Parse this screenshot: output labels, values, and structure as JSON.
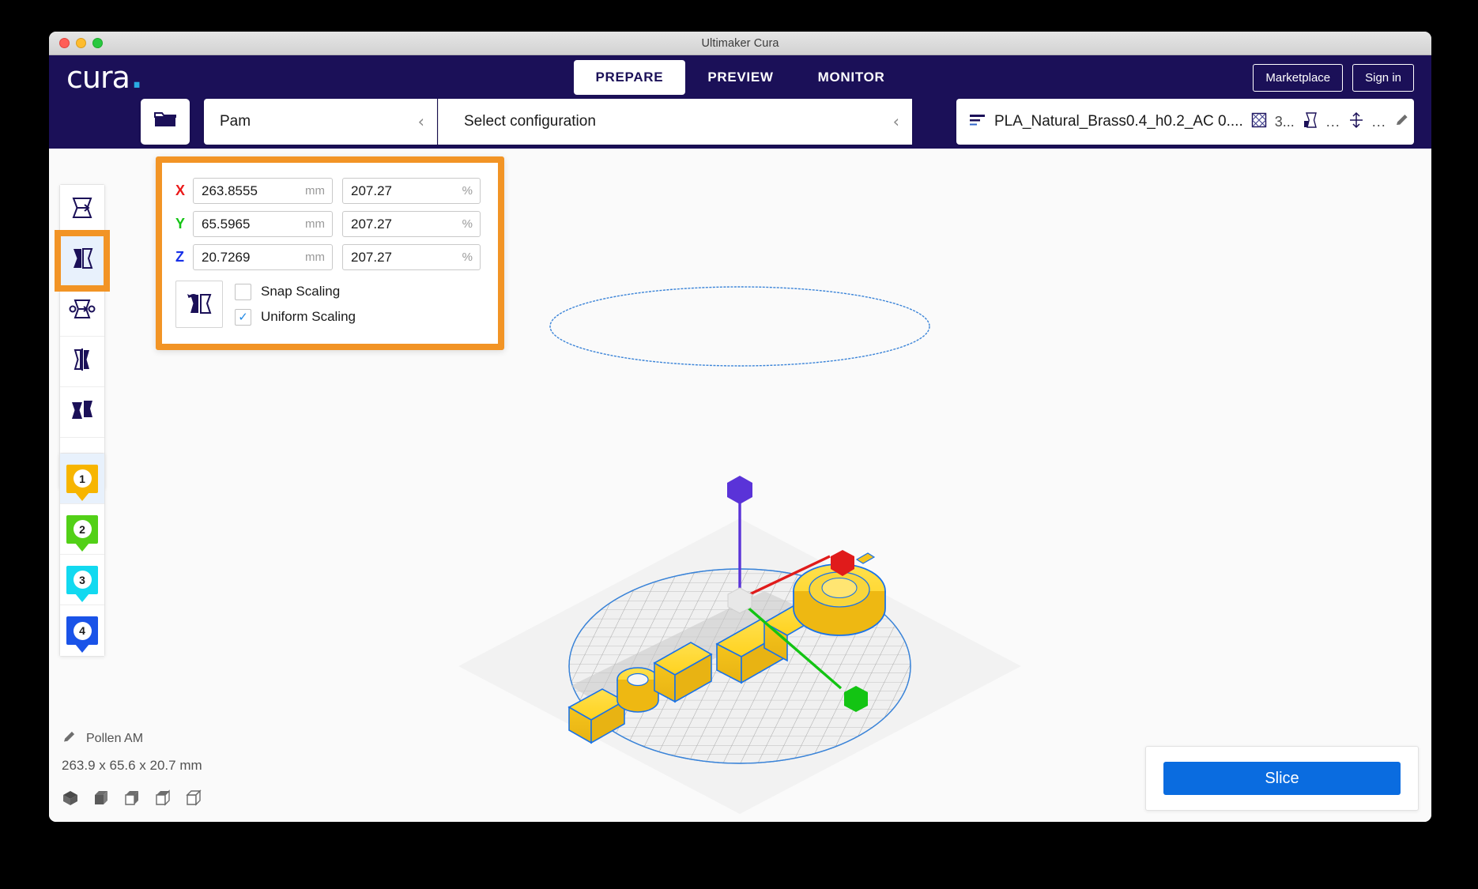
{
  "window": {
    "title": "Ultimaker Cura",
    "traffic_lights": [
      "close-red",
      "minimize-amber",
      "maximize-green"
    ]
  },
  "brand": {
    "name": "cura",
    "accent_dot": ".",
    "accent_color": "#29abe2",
    "bar_color": "#1b1058"
  },
  "topnav": {
    "tabs": [
      {
        "label": "PREPARE",
        "active": true
      },
      {
        "label": "PREVIEW",
        "active": false
      },
      {
        "label": "MONITOR",
        "active": false
      }
    ],
    "marketplace_label": "Marketplace",
    "signin_label": "Sign in"
  },
  "configbar": {
    "open_file_icon": "folder-open-icon",
    "machine_name": "Pam",
    "configuration_label": "Select configuration",
    "collapse_icon": "chevron-left-icon",
    "material": {
      "profile_icon": "layers-icon",
      "profile_name": "PLA_Natural_Brass0.4_h0.2_AC 0....",
      "infill_icon": "infill-icon",
      "infill_value": "3...",
      "support_icon": "support-icon",
      "support_value": "...",
      "adhesion_icon": "adhesion-icon",
      "adhesion_value": "...",
      "edit_icon": "pencil-icon"
    }
  },
  "toolbar": {
    "tools": [
      {
        "name": "move-tool",
        "icon": "move-icon",
        "selected": false
      },
      {
        "name": "scale-tool",
        "icon": "scale-icon",
        "selected": true
      },
      {
        "name": "rotate-tool",
        "icon": "rotate-icon",
        "selected": false
      },
      {
        "name": "mirror-tool",
        "icon": "mirror-icon",
        "selected": false
      },
      {
        "name": "per-model-settings-tool",
        "icon": "per-model-icon",
        "selected": false
      },
      {
        "name": "support-blocker-tool",
        "icon": "support-blocker-icon",
        "selected": false
      }
    ]
  },
  "extruders": [
    {
      "number": "1",
      "color": "#f7b500",
      "selected": true
    },
    {
      "number": "2",
      "color": "#52d017",
      "selected": false
    },
    {
      "number": "3",
      "color": "#12d9f0",
      "selected": false
    },
    {
      "number": "4",
      "color": "#1a53e8",
      "selected": false
    }
  ],
  "scale_panel": {
    "highlight_color": "#f29425",
    "axes": [
      {
        "axis": "X",
        "axis_color": "#eb1919",
        "mm_value": "263.8555",
        "mm_unit": "mm",
        "percent_value": "207.27",
        "percent_unit": "%"
      },
      {
        "axis": "Y",
        "axis_color": "#14c414",
        "mm_value": "65.5965",
        "mm_unit": "mm",
        "percent_value": "207.27",
        "percent_unit": "%"
      },
      {
        "axis": "Z",
        "axis_color": "#1730e8",
        "mm_value": "20.7269",
        "mm_unit": "mm",
        "percent_value": "207.27",
        "percent_unit": "%"
      }
    ],
    "reset_icon": "reset-scale-icon",
    "snap_scaling": {
      "label": "Snap Scaling",
      "checked": false
    },
    "uniform_scaling": {
      "label": "Uniform Scaling",
      "checked": true,
      "check_glyph": "✓"
    }
  },
  "model_info": {
    "edit_icon": "pencil-icon",
    "object_name": "Pollen AM",
    "dimensions": "263.9 x 65.6 x 20.7 mm",
    "view_modes": [
      {
        "name": "view-3d",
        "icon": "cube-iso-icon"
      },
      {
        "name": "view-front",
        "icon": "cube-front-icon"
      },
      {
        "name": "view-top",
        "icon": "cube-top-icon"
      },
      {
        "name": "view-left",
        "icon": "cube-left-icon"
      },
      {
        "name": "view-right",
        "icon": "cube-right-icon"
      }
    ]
  },
  "action_panel": {
    "slice_label": "Slice",
    "slice_color": "#0a6ce0"
  },
  "viewport": {
    "model_color": "#ffd21f",
    "selection_outline": "#1a73e8",
    "buildplate_outline": "#2f7fd8",
    "gizmo": {
      "x_handle_color": "#e01b1b",
      "y_handle_color": "#13c413",
      "z_handle_color": "#5a33d8",
      "center_handle_color": "#e8e8e8"
    }
  }
}
